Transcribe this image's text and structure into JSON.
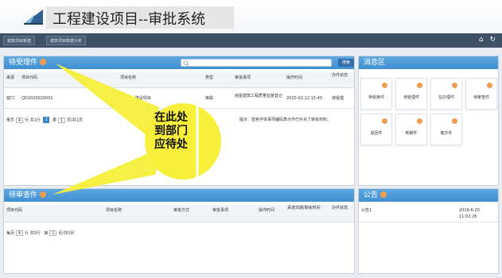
{
  "app": {
    "title": "工程建设项目--审批系统"
  },
  "nav": {
    "tabs": [
      "建筑项目新建",
      "建筑项目数据分析"
    ],
    "icons": [
      "home-icon",
      "refresh-icon"
    ]
  },
  "pending": {
    "title": "待受理件",
    "search_button": "搜索",
    "columns": [
      "来源",
      "项目代码",
      "项目名称",
      "类型",
      "审批事项",
      "操作时间",
      "办件状态"
    ],
    "rows": [
      {
        "source": "窗口",
        "code": "QD2020020001",
        "name": "...建设项目",
        "type": "串联",
        "item": "房屋建筑工程质量监督登记",
        "time": "2020-02-12 15:43",
        "status": "待受理"
      }
    ],
    "pager": {
      "per_page_label": "每页",
      "per_page_value": "4",
      "rows_label": "行 共1行",
      "page_label": "第",
      "page_value": "1",
      "pages_label": "页/共1页",
      "current_page": "1"
    },
    "hint": "提示：蓝色字体事项编码表示作已补充了审批材料。"
  },
  "review": {
    "title": "待审查件",
    "columns": [
      "项目代码",
      "项目名称",
      "审批方式",
      "审批事项",
      "操作时间",
      "承诺日期/剩余时间",
      "办件状态"
    ],
    "pager": {
      "per_page_label": "每页",
      "per_page_value": "4",
      "rows_label": "行 共0行",
      "page_label": "第",
      "page_value": "1",
      "pages_label": "页/共0页"
    }
  },
  "messages": {
    "title": "消息区",
    "tiles": [
      "待受审件",
      "待受理件",
      "在办理件",
      "待审查件",
      "退回件",
      "到期件",
      "催办件"
    ]
  },
  "notice": {
    "title": "公告",
    "items": [
      {
        "name": "公告1",
        "date": "2019-6-20",
        "time": "11:02:26"
      }
    ]
  },
  "callout": {
    "line1": "在此处",
    "line2": "到部门",
    "line3": "应待处"
  },
  "colors": {
    "header_blue": "#4a9ad9",
    "nav_dark": "#3e5166",
    "accent_orange": "#f29c4e",
    "callout_yellow": "#f7ef3a"
  }
}
